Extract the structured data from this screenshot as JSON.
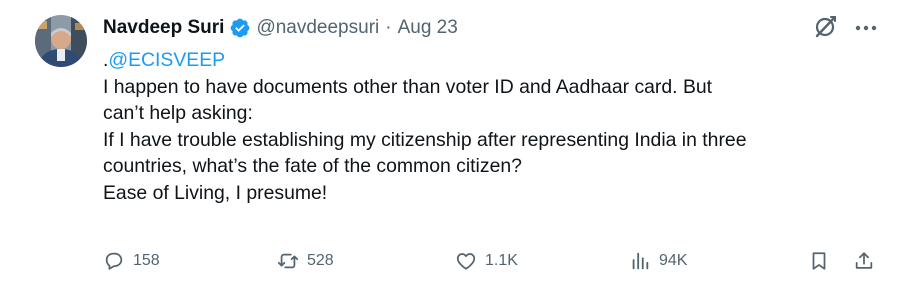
{
  "tweet": {
    "author": {
      "name": "Navdeep Suri",
      "handle": "@navdeepsuri",
      "verified": true
    },
    "separator": "·",
    "date": "Aug 23",
    "body": {
      "prefix": ".",
      "mention": "@ECISVEEP",
      "lines": [
        "I happen to have documents other than voter ID and Aadhaar card. But",
        "can’t help asking:",
        "If I have trouble establishing my citizenship after representing India in three",
        "countries, what’s the fate of the common citizen?",
        "Ease of Living, I presume!"
      ]
    },
    "actions": {
      "replies": "158",
      "reposts": "528",
      "likes": "1.1K",
      "views": "94K"
    },
    "icons": {
      "verified": "verified-badge-icon",
      "grok": "grok-icon",
      "more": "more-icon",
      "reply": "reply-icon",
      "repost": "repost-icon",
      "like": "heart-icon",
      "views": "views-icon",
      "bookmark": "bookmark-icon",
      "share": "share-icon"
    },
    "colors": {
      "text": "#0f1419",
      "secondary": "#536471",
      "link": "#1d9bf0",
      "verified": "#1d9bf0"
    }
  }
}
